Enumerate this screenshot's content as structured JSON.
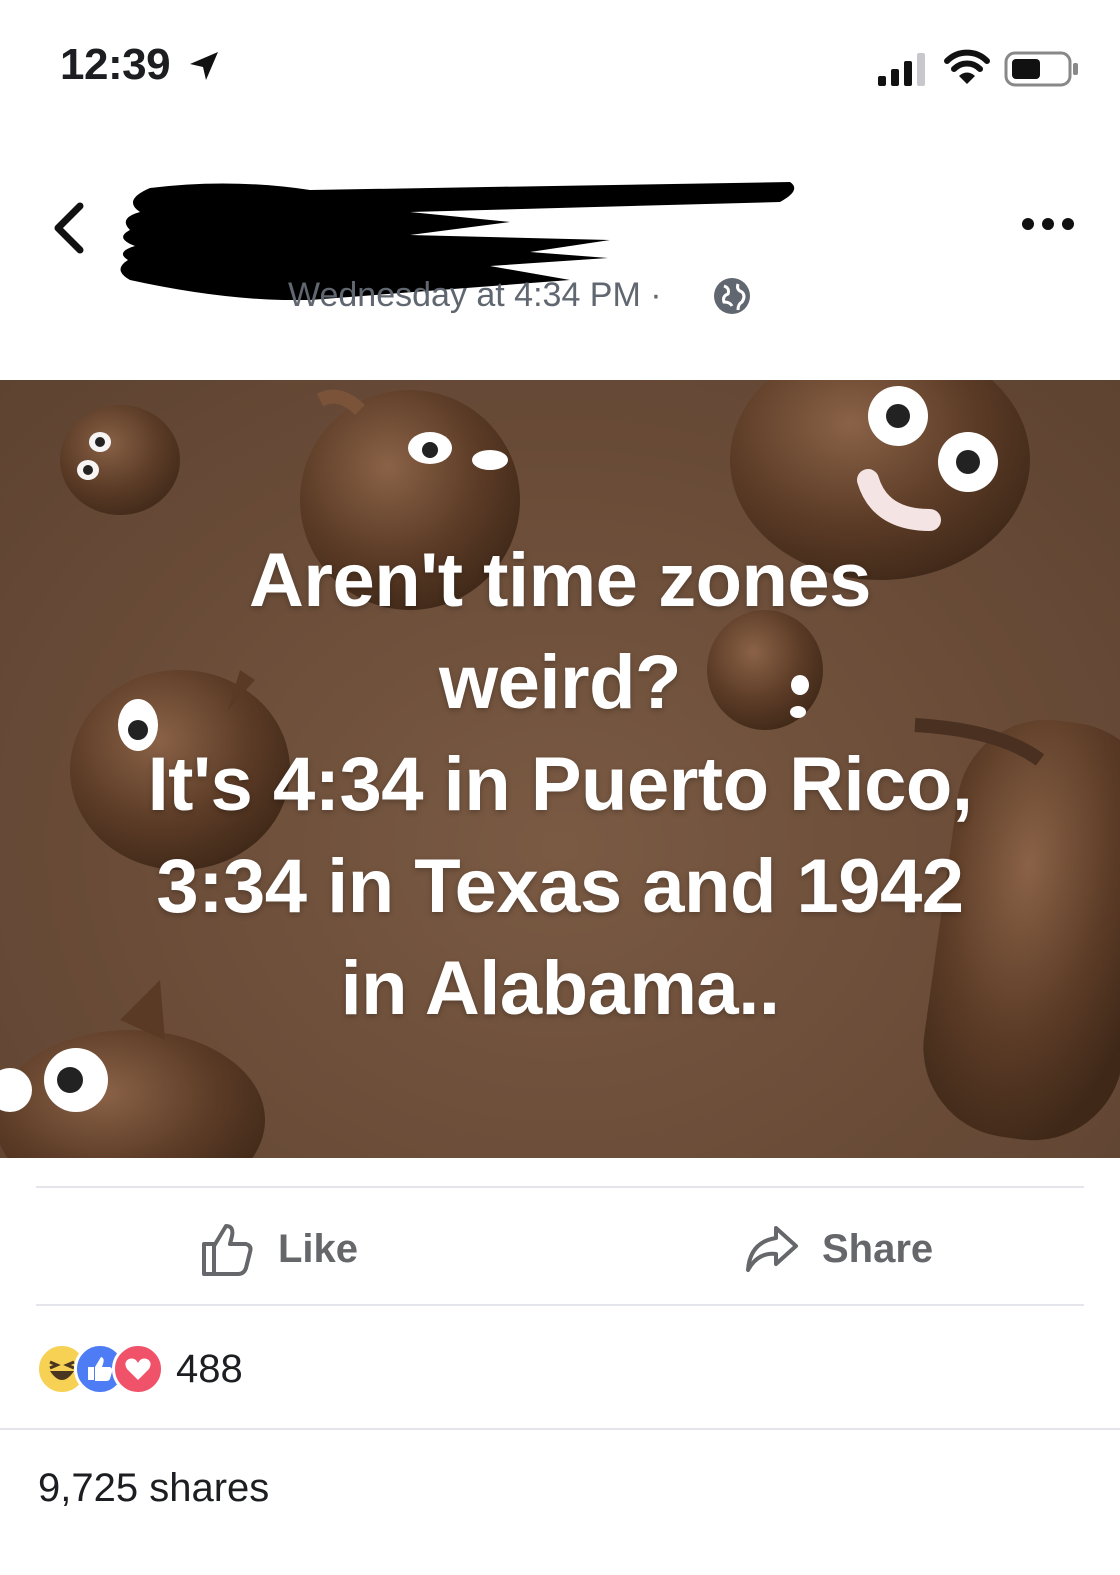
{
  "status_bar": {
    "time": "12:39",
    "icons": [
      "location-arrow-icon",
      "cellular-signal-icon",
      "wifi-icon",
      "battery-icon"
    ]
  },
  "post": {
    "timestamp": "Wednesday at 4:34 PM ·",
    "audience_icon": "globe-icon",
    "author_redacted": true,
    "image_text": [
      "Aren't time zones",
      "weird?",
      "It's 4:34 in Puerto Rico,",
      "3:34 in Texas and 1942",
      "in Alabama.."
    ]
  },
  "actions": {
    "like_label": "Like",
    "share_label": "Share"
  },
  "reactions": {
    "types": [
      "haha",
      "like",
      "love"
    ],
    "count": "488"
  },
  "shares_text": "9,725 shares",
  "colors": {
    "image_background": "#6a4c38",
    "like_blue": "#4d7cf4",
    "love_red": "#f0526a",
    "haha_yellow": "#f7d154",
    "muted_text": "#606770"
  }
}
